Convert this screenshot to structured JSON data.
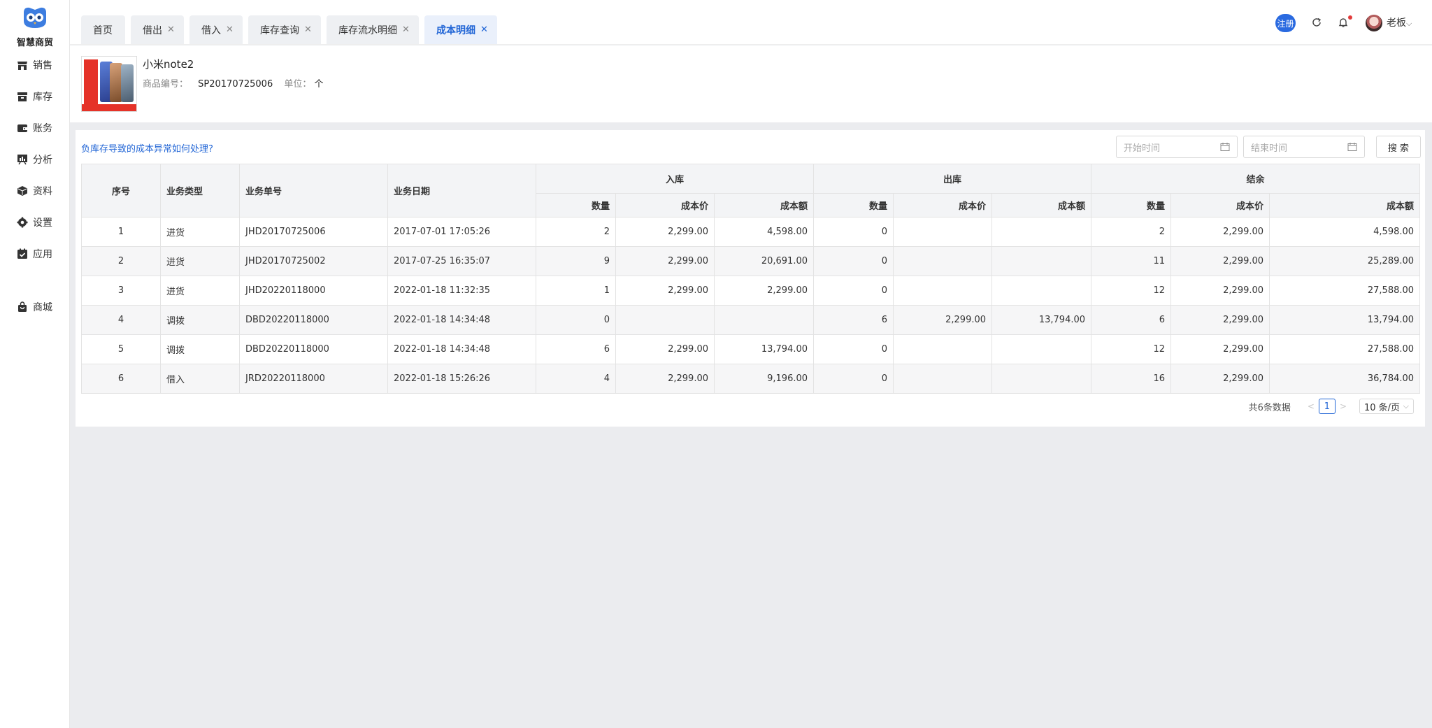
{
  "logo": {
    "text": "智慧商贸"
  },
  "sidebar": {
    "items": [
      {
        "label": "销售",
        "icon": "store-icon"
      },
      {
        "label": "库存",
        "icon": "box-icon"
      },
      {
        "label": "账务",
        "icon": "wallet-icon"
      },
      {
        "label": "分析",
        "icon": "chart-board-icon"
      },
      {
        "label": "资料",
        "icon": "cube-icon"
      },
      {
        "label": "设置",
        "icon": "gear-icon"
      },
      {
        "label": "应用",
        "icon": "calendar-app-icon"
      },
      {
        "label": "商城",
        "icon": "bag-icon"
      }
    ]
  },
  "tabs": [
    {
      "label": "首页",
      "closable": false
    },
    {
      "label": "借出",
      "closable": true
    },
    {
      "label": "借入",
      "closable": true
    },
    {
      "label": "库存查询",
      "closable": true
    },
    {
      "label": "库存流水明细",
      "closable": true
    },
    {
      "label": "成本明细",
      "closable": true,
      "active": true
    }
  ],
  "header": {
    "register_badge": "注册",
    "user_name": "老板"
  },
  "product": {
    "name": "小米note2",
    "code_label": "商品编号：",
    "code": "SP20170725006",
    "unit_label": "单位：",
    "unit": "个"
  },
  "toolbar": {
    "help_link": "负库存导致的成本异常如何处理?",
    "start_placeholder": "开始时间",
    "end_placeholder": "结束时间",
    "search_label": "搜 索"
  },
  "table": {
    "headers": {
      "index": "序号",
      "type": "业务类型",
      "doc_no": "业务单号",
      "date": "业务日期",
      "group_in": "入库",
      "group_out": "出库",
      "group_balance": "结余",
      "qty": "数量",
      "unit_cost": "成本价",
      "amount": "成本额"
    },
    "rows": [
      {
        "index": "1",
        "type": "进货",
        "doc_no": "JHD20170725006",
        "date": "2017-07-01 17:05:26",
        "in_qty": "2",
        "in_price": "2,299.00",
        "in_amount": "4,598.00",
        "out_qty": "0",
        "out_price": "",
        "out_amount": "",
        "bal_qty": "2",
        "bal_price": "2,299.00",
        "bal_amount": "4,598.00"
      },
      {
        "index": "2",
        "type": "进货",
        "doc_no": "JHD20170725002",
        "date": "2017-07-25 16:35:07",
        "in_qty": "9",
        "in_price": "2,299.00",
        "in_amount": "20,691.00",
        "out_qty": "0",
        "out_price": "",
        "out_amount": "",
        "bal_qty": "11",
        "bal_price": "2,299.00",
        "bal_amount": "25,289.00"
      },
      {
        "index": "3",
        "type": "进货",
        "doc_no": "JHD20220118000",
        "date": "2022-01-18 11:32:35",
        "in_qty": "1",
        "in_price": "2,299.00",
        "in_amount": "2,299.00",
        "out_qty": "0",
        "out_price": "",
        "out_amount": "",
        "bal_qty": "12",
        "bal_price": "2,299.00",
        "bal_amount": "27,588.00"
      },
      {
        "index": "4",
        "type": "调拨",
        "doc_no": "DBD20220118000",
        "date": "2022-01-18 14:34:48",
        "in_qty": "0",
        "in_price": "",
        "in_amount": "",
        "out_qty": "6",
        "out_price": "2,299.00",
        "out_amount": "13,794.00",
        "bal_qty": "6",
        "bal_price": "2,299.00",
        "bal_amount": "13,794.00"
      },
      {
        "index": "5",
        "type": "调拨",
        "doc_no": "DBD20220118000",
        "date": "2022-01-18 14:34:48",
        "in_qty": "6",
        "in_price": "2,299.00",
        "in_amount": "13,794.00",
        "out_qty": "0",
        "out_price": "",
        "out_amount": "",
        "bal_qty": "12",
        "bal_price": "2,299.00",
        "bal_amount": "27,588.00"
      },
      {
        "index": "6",
        "type": "借入",
        "doc_no": "JRD20220118000",
        "date": "2022-01-18 15:26:26",
        "in_qty": "4",
        "in_price": "2,299.00",
        "in_amount": "9,196.00",
        "out_qty": "0",
        "out_price": "",
        "out_amount": "",
        "bal_qty": "16",
        "bal_price": "2,299.00",
        "bal_amount": "36,784.00"
      }
    ]
  },
  "pagination": {
    "total_text": "共6条数据",
    "current_page": "1",
    "page_size": "10 条/页"
  },
  "colors": {
    "accent": "#2266d6",
    "register_badge": "#2a6ae0",
    "notification_dot": "#e23b3b"
  }
}
